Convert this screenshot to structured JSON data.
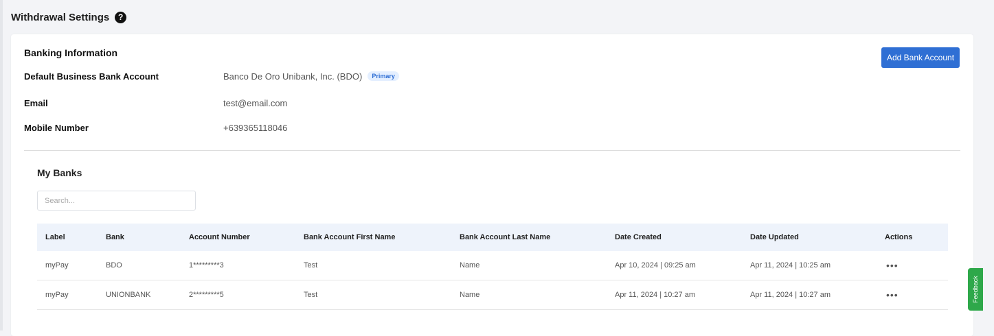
{
  "header": {
    "title": "Withdrawal Settings",
    "help_icon": "question-circle-icon"
  },
  "banking": {
    "title": "Banking Information",
    "add_button": "Add Bank Account",
    "default_account_label": "Default Business Bank Account",
    "default_account_value": "Banco De Oro Unibank, Inc. (BDO)",
    "primary_badge": "Primary",
    "email_label": "Email",
    "email_value": "test@email.com",
    "mobile_label": "Mobile Number",
    "mobile_value": "+639365118046"
  },
  "my_banks": {
    "title": "My Banks",
    "search_placeholder": "Search...",
    "columns": [
      "Label",
      "Bank",
      "Account Number",
      "Bank Account First Name",
      "Bank Account Last Name",
      "Date Created",
      "Date Updated",
      "Actions"
    ],
    "rows": [
      [
        "myPay",
        "BDO",
        "1*********3",
        "Test",
        "Name",
        "Apr 10, 2024 | 09:25 am",
        "Apr 11, 2024 | 10:25 am",
        "•••"
      ],
      [
        "myPay",
        "UNIONBANK",
        "2*********5",
        "Test",
        "Name",
        "Apr 11, 2024 | 10:27 am",
        "Apr 11, 2024 | 10:27 am",
        "•••"
      ]
    ]
  },
  "feedback": {
    "label": "Feedback"
  },
  "colors": {
    "accent": "#2f6fd4",
    "feedback": "#2ea84a",
    "table_header": "#eef3fb"
  }
}
